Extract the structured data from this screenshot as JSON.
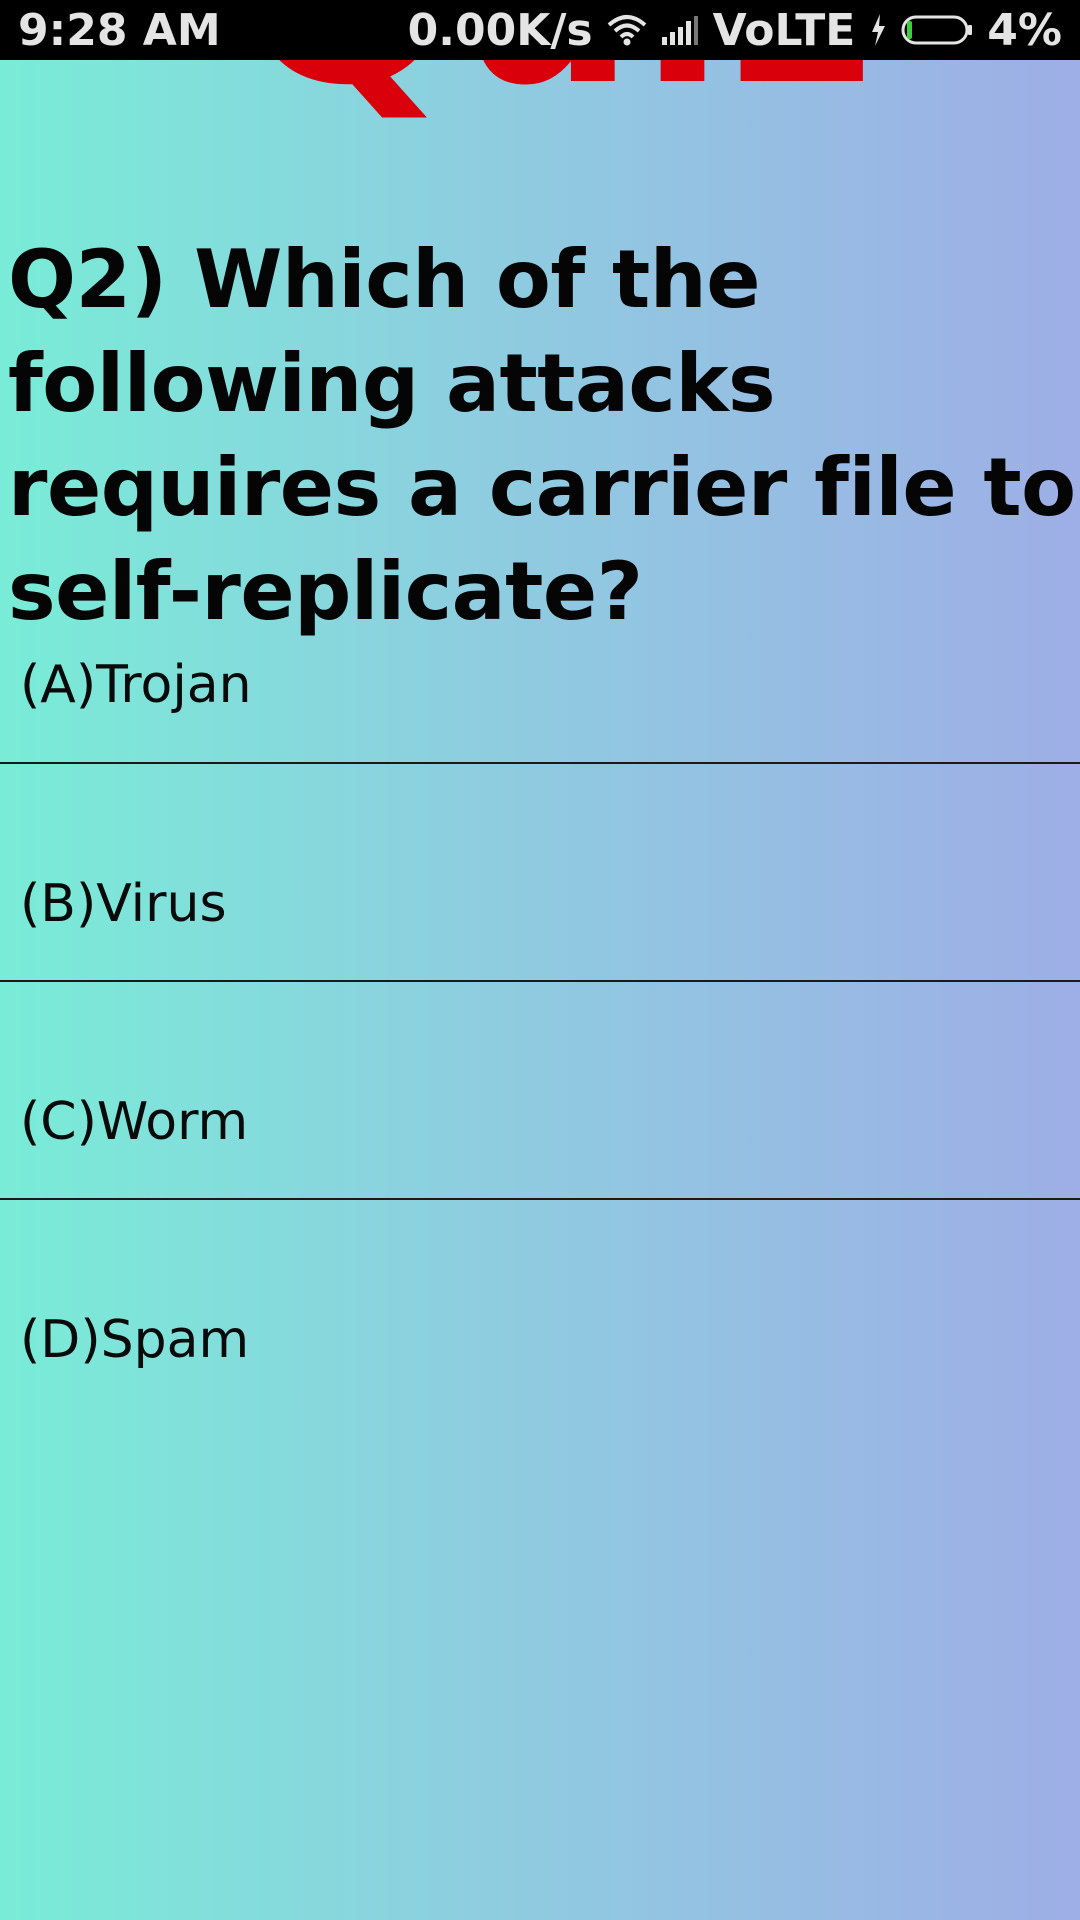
{
  "status_bar": {
    "time": "9:28 AM",
    "network_speed": "0.00K/s",
    "network_type": "VoLTE",
    "battery": "4%",
    "icons": [
      "wifi-icon",
      "signal-icon",
      "charging-icon",
      "battery-icon"
    ]
  },
  "header": {
    "logo_text": "Quiz",
    "logo_color": "#d9000b"
  },
  "question": {
    "text": "Q2) Which of the following attacks requires a carrier file to self-replicate?"
  },
  "options": [
    {
      "label": "(A)Trojan"
    },
    {
      "label": "(B)Virus"
    },
    {
      "label": "(C)Worm"
    },
    {
      "label": "(D)Spam"
    }
  ]
}
